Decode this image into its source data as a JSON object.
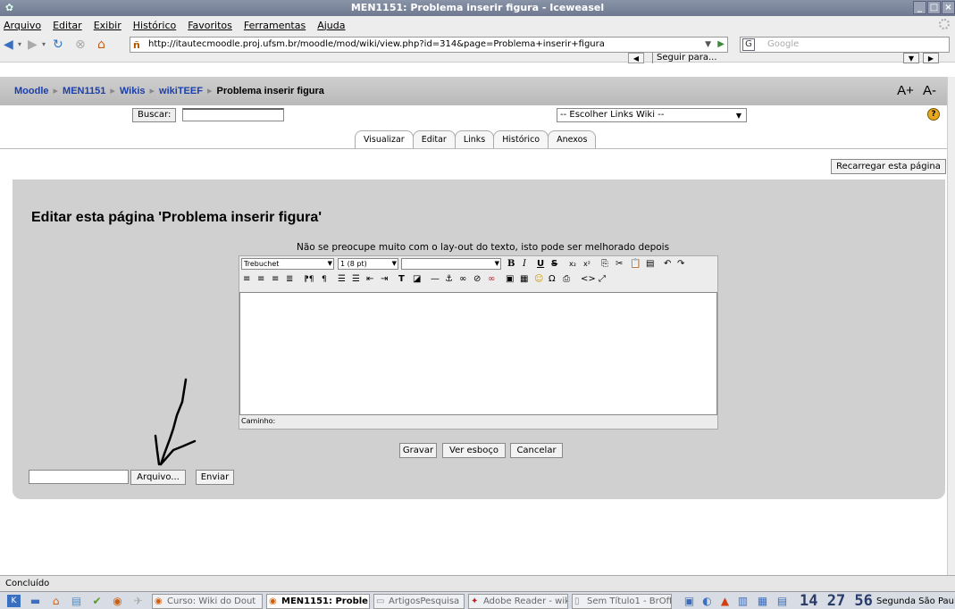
{
  "window": {
    "title": "MEN1151: Problema inserir figura - Iceweasel"
  },
  "menubar": [
    "Arquivo",
    "Editar",
    "Exibir",
    "Histórico",
    "Favoritos",
    "Ferramentas",
    "Ajuda"
  ],
  "navbar": {
    "url": "http://itautecmoodle.proj.ufsm.br/moodle/mod/wiki/view.php?id=314&page=Problema+inserir+figura",
    "search_placeholder": "Google",
    "search_engine_letter": "G",
    "seguir_label": "Seguir para..."
  },
  "breadcrumb": [
    "Moodle",
    "MEN1151",
    "Wikis",
    "wikiTEEF",
    "Problema inserir figura"
  ],
  "fontsize": {
    "increase": "A+",
    "decrease": "A-"
  },
  "search": {
    "button": "Buscar:",
    "value": ""
  },
  "links_select": {
    "selected": "-- Escolher Links Wiki --"
  },
  "tabs": [
    "Visualizar",
    "Editar",
    "Links",
    "Histórico",
    "Anexos"
  ],
  "recarregar": "Recarregar esta página",
  "heading": "Editar esta página 'Problema inserir figura'",
  "note": "Não se preocupe muito com o lay-out do texto, isto pode ser melhorado depois",
  "editor": {
    "font_family": "Trebuchet",
    "font_size": "1 (8 pt)",
    "format": "",
    "path_label": "Caminho:"
  },
  "buttons": {
    "gravar": "Gravar",
    "esboco": "Ver esboço",
    "cancelar": "Cancelar",
    "arquivo": "Arquivo...",
    "enviar": "Enviar"
  },
  "status": "Concluído",
  "taskbar": {
    "tasks": [
      {
        "label": "Curso: Wiki do Dout",
        "active": false
      },
      {
        "label": "MEN1151: Proble",
        "active": true
      },
      {
        "label": "ArtigosPesquisa",
        "active": false
      },
      {
        "label": "Adobe Reader - wiki",
        "active": false
      },
      {
        "label": "Sem Título1 - BrOff",
        "active": false
      }
    ],
    "clock": "14 27 56",
    "date": "Segunda  São Paulo"
  }
}
